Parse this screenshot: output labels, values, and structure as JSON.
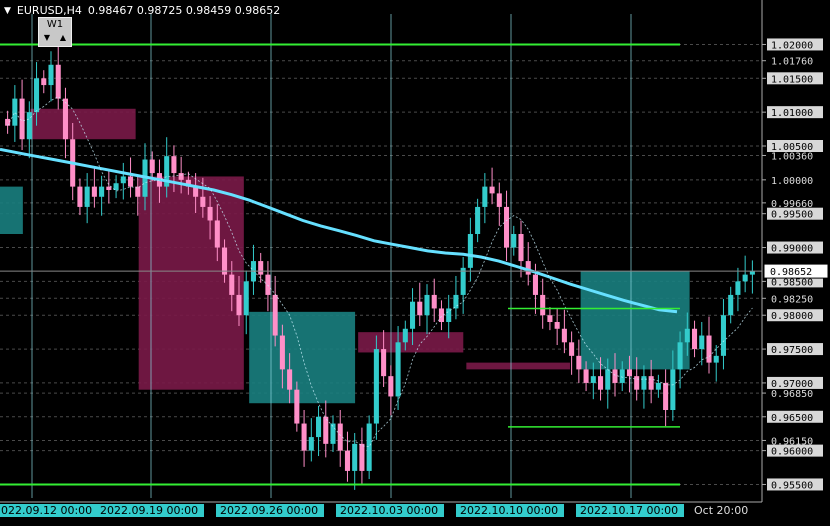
{
  "header": {
    "symbol": "EURUSD,H4",
    "ohlc": "0.98467 0.98725 0.98459 0.98652"
  },
  "widget": {
    "label": "W1",
    "down": "▼",
    "up": "▲"
  },
  "colors": {
    "background": "#000000",
    "grid": "#4a4a4a",
    "bull": "#33cccc",
    "bear": "#ff8fc8",
    "ma": "#66e0ff",
    "bear_zone": "#7a1a48",
    "bull_zone": "#1a7f7f",
    "level_line": "#33ee33"
  },
  "chart_data": {
    "type": "candlestick",
    "symbol": "EURUSD",
    "timeframe": "H4",
    "ylim": [
      0.953,
      1.0245
    ],
    "price_ticks": [
      "1.02000",
      "1.01760",
      "1.01500",
      "1.01000",
      "1.00500",
      "1.00360",
      "1.00000",
      "0.99660",
      "0.99500",
      "0.99000",
      "0.98500",
      "0.98250",
      "0.98000",
      "0.97500",
      "0.97000",
      "0.96850",
      "0.96500",
      "0.96150",
      "0.96000",
      "0.95500"
    ],
    "current_price": "0.98652",
    "time_labels": [
      "2022.09.12 00:00",
      "2022.09.19 00:00",
      "2022.09.26 00:00",
      "2022.10.03 00:00",
      "2022.10.10 00:00",
      "2022.10.17 00:00",
      "Oct 20:00"
    ],
    "horizontal_levels": [
      1.02,
      0.955
    ],
    "zone_levels": [
      0.981,
      0.9635
    ],
    "closes": [
      1.008,
      1.012,
      1.006,
      1.01,
      1.015,
      1.014,
      1.017,
      1.012,
      1.006,
      0.999,
      0.996,
      0.999,
      0.9975,
      0.999,
      0.9985,
      0.9995,
      1.0005,
      0.999,
      0.9975,
      1.003,
      1.001,
      0.999,
      1.0035,
      1.001,
      1.0,
      0.999,
      0.9975,
      0.996,
      0.994,
      0.99,
      0.986,
      0.983,
      0.98,
      0.985,
      0.988,
      0.986,
      0.983,
      0.977,
      0.972,
      0.969,
      0.964,
      0.96,
      0.962,
      0.965,
      0.961,
      0.964,
      0.96,
      0.957,
      0.961,
      0.957,
      0.964,
      0.975,
      0.971,
      0.968,
      0.976,
      0.978,
      0.982,
      0.98,
      0.983,
      0.981,
      0.979,
      0.981,
      0.983,
      0.987,
      0.992,
      0.996,
      0.999,
      0.998,
      0.996,
      0.99,
      0.992,
      0.988,
      0.986,
      0.983,
      0.98,
      0.979,
      0.978,
      0.976,
      0.974,
      0.972,
      0.97,
      0.971,
      0.969,
      0.972,
      0.97,
      0.972,
      0.971,
      0.969,
      0.971,
      0.969,
      0.97,
      0.966,
      0.972,
      0.976,
      0.978,
      0.975,
      0.977,
      0.973,
      0.974,
      0.98,
      0.983,
      0.985,
      0.986,
      0.9865
    ],
    "series": [
      {
        "name": "",
        "type": "moving_average",
        "values": [
          1.0045,
          1.004,
          1.0035,
          1.003,
          1.0025,
          1.002,
          1.0015,
          1.001,
          1.0005,
          1.0,
          0.9995,
          0.999,
          0.9985,
          0.9978,
          0.997,
          0.996,
          0.995,
          0.994,
          0.9932,
          0.9925,
          0.9918,
          0.991,
          0.9905,
          0.99,
          0.9895,
          0.9892,
          0.989,
          0.9886,
          0.988,
          0.9872,
          0.9864,
          0.9855,
          0.9846,
          0.9838,
          0.983,
          0.9822,
          0.9815,
          0.9808,
          0.9805
        ]
      }
    ],
    "rectangles": [
      {
        "kind": "bull",
        "x0": 0.0,
        "x1": 0.03,
        "y0": 0.992,
        "y1": 0.999
      },
      {
        "kind": "bear",
        "x0": 0.04,
        "x1": 0.178,
        "y0": 1.006,
        "y1": 1.0105
      },
      {
        "kind": "bear",
        "x0": 0.182,
        "x1": 0.32,
        "y0": 0.969,
        "y1": 1.0005
      },
      {
        "kind": "bull",
        "x0": 0.327,
        "x1": 0.466,
        "y0": 0.967,
        "y1": 0.9805
      },
      {
        "kind": "bear",
        "x0": 0.47,
        "x1": 0.608,
        "y0": 0.9745,
        "y1": 0.9775
      },
      {
        "kind": "bear",
        "x0": 0.612,
        "x1": 0.748,
        "y0": 0.972,
        "y1": 0.973
      },
      {
        "kind": "bull",
        "x0": 0.762,
        "x1": 0.905,
        "y0": 0.972,
        "y1": 0.9865
      }
    ]
  }
}
